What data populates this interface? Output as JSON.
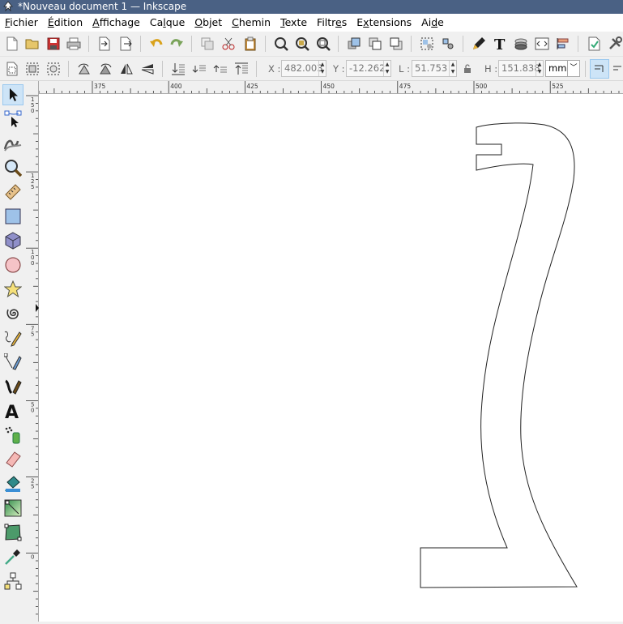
{
  "window": {
    "title": "*Nouveau document 1 — Inkscape"
  },
  "menu": [
    {
      "label": "Fichier",
      "key": "F"
    },
    {
      "label": "Édition",
      "key": "É"
    },
    {
      "label": "Affichage",
      "key": "A"
    },
    {
      "label": "Calque",
      "key": "l"
    },
    {
      "label": "Objet",
      "key": "O"
    },
    {
      "label": "Chemin",
      "key": "C"
    },
    {
      "label": "Texte",
      "key": "T"
    },
    {
      "label": "Filtres",
      "key": "e"
    },
    {
      "label": "Extensions",
      "key": "x"
    },
    {
      "label": "Aide",
      "key": "d"
    }
  ],
  "select_toolbar": {
    "x_label": "X :",
    "x_value": "482.003",
    "y_label": "Y :",
    "y_value": "-12.262",
    "w_label": "L :",
    "w_value": "51.753",
    "h_label": "H :",
    "h_value": "151.838",
    "unit": "mm"
  },
  "rulers": {
    "horizontal": [
      "375",
      "400",
      "425",
      "450",
      "475",
      "500",
      "525"
    ],
    "vertical": [
      {
        "chars": [
          "1",
          "5",
          "0"
        ]
      },
      {
        "chars": [
          "1",
          "2",
          "5"
        ]
      },
      {
        "chars": [
          "1",
          "0",
          "0"
        ]
      },
      {
        "chars": [
          "7",
          "5"
        ]
      },
      {
        "chars": [
          "5",
          "0"
        ]
      },
      {
        "chars": [
          "2",
          "5"
        ]
      },
      {
        "chars": [
          "0"
        ]
      }
    ]
  },
  "icons": {
    "app": "inkscape-logo-icon",
    "tools": [
      "selector-tool-icon",
      "node-tool-icon",
      "tweak-tool-icon",
      "zoom-tool-icon",
      "measure-tool-icon",
      "rectangle-tool-icon",
      "3d-box-tool-icon",
      "ellipse-tool-icon",
      "star-tool-icon",
      "spiral-tool-icon",
      "pencil-tool-icon",
      "pen-tool-icon",
      "calligraphy-tool-icon",
      "text-tool-icon",
      "spray-tool-icon",
      "eraser-tool-icon",
      "paint-bucket-tool-icon",
      "gradient-tool-icon",
      "mesh-tool-icon",
      "dropper-tool-icon",
      "connector-tool-icon"
    ]
  },
  "colors": {
    "titlebar": "#4a6184",
    "active_tool": "#cde4f7",
    "canvas": "#ffffff"
  }
}
